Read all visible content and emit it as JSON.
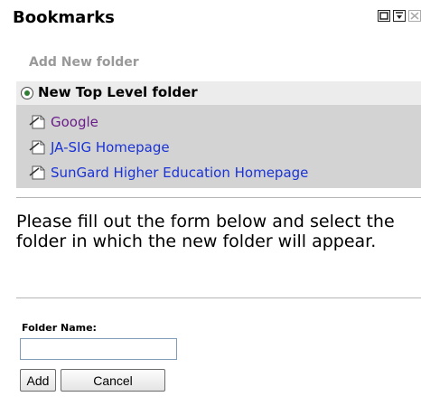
{
  "portlet": {
    "title": "Bookmarks",
    "controls": [
      "portlet-minimize-icon",
      "portlet-maximize-icon",
      "portlet-close-icon"
    ]
  },
  "actions": {
    "add_new_folder": "Add New folder"
  },
  "tree": {
    "top_folder": "New Top Level folder",
    "bookmarks": [
      {
        "label": "Google",
        "icon": "bookmark-page-icon",
        "visited": true
      },
      {
        "label": "JA-SIG Homepage",
        "icon": "bookmark-page-icon",
        "visited": false
      },
      {
        "label": "SunGard Higher Education Homepage",
        "icon": "bookmark-page-icon",
        "visited": false
      }
    ]
  },
  "form": {
    "instructions": "Please fill out the form below and select the folder in which the new folder will appear.",
    "folder_name_label": "Folder Name:",
    "folder_name_value": "",
    "add_button": "Add",
    "cancel_button": "Cancel"
  },
  "colors": {
    "link": "#1a33d6",
    "visited_link": "#6a1c8a",
    "tree_background": "#d3d3d3",
    "selected_row": "#ececec",
    "disabled_text": "#999999"
  }
}
